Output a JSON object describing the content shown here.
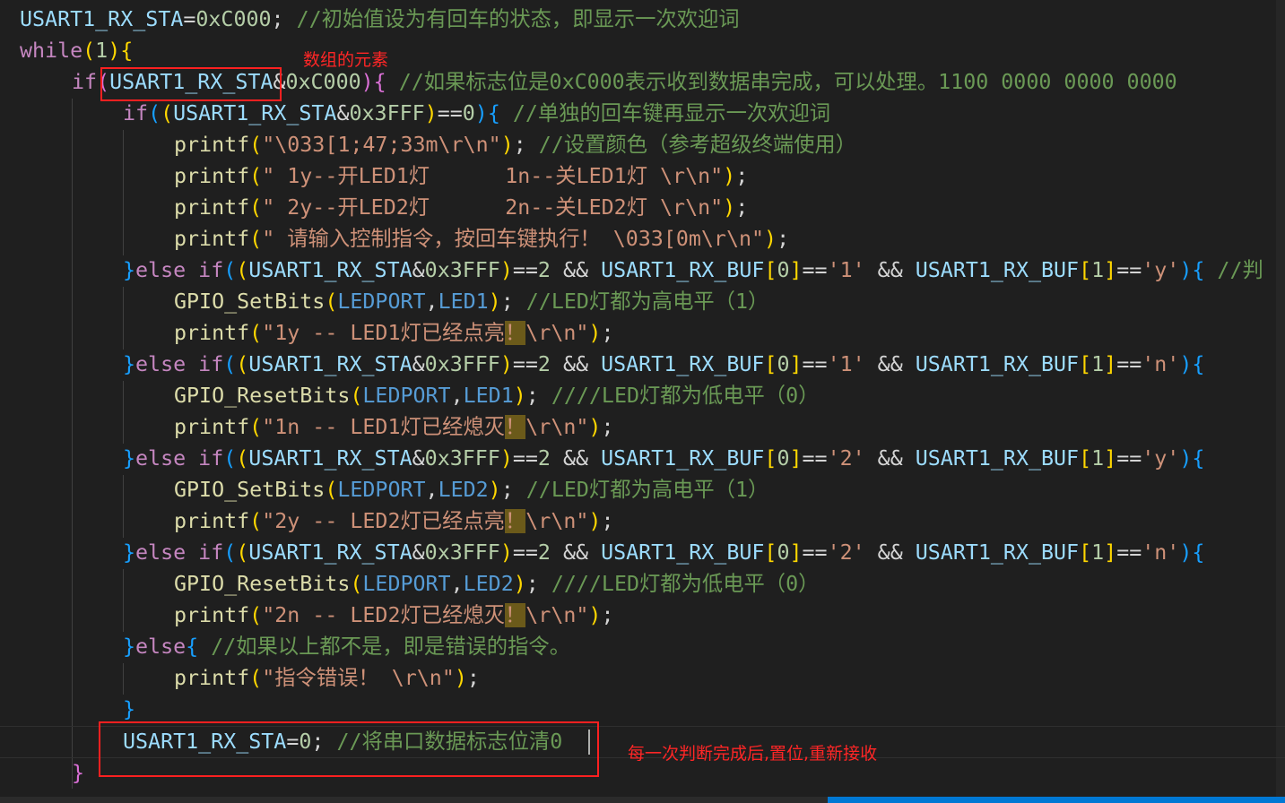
{
  "code": {
    "line0": [
      {
        "t": "USART1_RX_STA",
        "c": "t-var"
      },
      {
        "t": "=",
        "c": "t-op"
      },
      {
        "t": "0xC000",
        "c": "t-num"
      },
      {
        "t": "; ",
        "c": "t-op"
      },
      {
        "t": "//初始值设为有回车的状态，即显示一次欢迎词",
        "c": "t-com"
      }
    ],
    "line1": [
      {
        "t": "while",
        "c": "t-kw"
      },
      {
        "t": "(",
        "c": "t-b1"
      },
      {
        "t": "1",
        "c": "t-num"
      },
      {
        "t": ")",
        "c": "t-b1"
      },
      {
        "t": "{",
        "c": "t-b1"
      }
    ],
    "line2": [
      {
        "t": "if",
        "c": "t-kw"
      },
      {
        "t": "(",
        "c": "t-b2"
      },
      {
        "t": "USART1_RX_STA",
        "c": "t-var"
      },
      {
        "t": "&",
        "c": "t-op"
      },
      {
        "t": "0xC000",
        "c": "t-num"
      },
      {
        "t": ")",
        "c": "t-b2"
      },
      {
        "t": "{",
        "c": "t-b2"
      },
      {
        "t": " //如果标志位是0xC000表示收到数据串完成，可以处理。1100 0000 0000 0000",
        "c": "t-com"
      }
    ],
    "line3": [
      {
        "t": "if",
        "c": "t-kw"
      },
      {
        "t": "(",
        "c": "t-b3"
      },
      {
        "t": "(",
        "c": "t-b1"
      },
      {
        "t": "USART1_RX_STA",
        "c": "t-var"
      },
      {
        "t": "&",
        "c": "t-op"
      },
      {
        "t": "0x3FFF",
        "c": "t-num"
      },
      {
        "t": ")",
        "c": "t-b1"
      },
      {
        "t": "==",
        "c": "t-op"
      },
      {
        "t": "0",
        "c": "t-num"
      },
      {
        "t": ")",
        "c": "t-b3"
      },
      {
        "t": "{",
        "c": "t-b3"
      },
      {
        "t": " //单独的回车键再显示一次欢迎词",
        "c": "t-com"
      }
    ],
    "line4": [
      {
        "t": "printf",
        "c": "t-fn"
      },
      {
        "t": "(",
        "c": "t-b1"
      },
      {
        "t": "\"\\033[1;47;33m\\r\\n\"",
        "c": "t-str"
      },
      {
        "t": ")",
        "c": "t-b1"
      },
      {
        "t": "; ",
        "c": "t-op"
      },
      {
        "t": "//设置颜色（参考超级终端使用）",
        "c": "t-com"
      }
    ],
    "line5": [
      {
        "t": "printf",
        "c": "t-fn"
      },
      {
        "t": "(",
        "c": "t-b1"
      },
      {
        "t": "\" 1y--开LED1灯      1n--关LED1灯 \\r\\n\"",
        "c": "t-str"
      },
      {
        "t": ")",
        "c": "t-b1"
      },
      {
        "t": ";",
        "c": "t-op"
      }
    ],
    "line6": [
      {
        "t": "printf",
        "c": "t-fn"
      },
      {
        "t": "(",
        "c": "t-b1"
      },
      {
        "t": "\" 2y--开LED2灯      2n--关LED2灯 \\r\\n\"",
        "c": "t-str"
      },
      {
        "t": ")",
        "c": "t-b1"
      },
      {
        "t": ";",
        "c": "t-op"
      }
    ],
    "line7": [
      {
        "t": "printf",
        "c": "t-fn"
      },
      {
        "t": "(",
        "c": "t-b1"
      },
      {
        "t": "\" 请输入控制指令，按回车键执行！ \\033[0m\\r\\n\"",
        "c": "t-str"
      },
      {
        "t": ")",
        "c": "t-b1"
      },
      {
        "t": ";",
        "c": "t-op"
      }
    ],
    "line8": [
      {
        "t": "}",
        "c": "t-b3"
      },
      {
        "t": "else ",
        "c": "t-kw"
      },
      {
        "t": "if",
        "c": "t-kw"
      },
      {
        "t": "(",
        "c": "t-b3"
      },
      {
        "t": "(",
        "c": "t-b1"
      },
      {
        "t": "USART1_RX_STA",
        "c": "t-var"
      },
      {
        "t": "&",
        "c": "t-op"
      },
      {
        "t": "0x3FFF",
        "c": "t-num"
      },
      {
        "t": ")",
        "c": "t-b1"
      },
      {
        "t": "==",
        "c": "t-op"
      },
      {
        "t": "2",
        "c": "t-num"
      },
      {
        "t": " && ",
        "c": "t-op"
      },
      {
        "t": "USART1_RX_BUF",
        "c": "t-var"
      },
      {
        "t": "[",
        "c": "t-b1"
      },
      {
        "t": "0",
        "c": "t-num"
      },
      {
        "t": "]",
        "c": "t-b1"
      },
      {
        "t": "==",
        "c": "t-op"
      },
      {
        "t": "'1'",
        "c": "t-str"
      },
      {
        "t": " && ",
        "c": "t-op"
      },
      {
        "t": "USART1_RX_BUF",
        "c": "t-var"
      },
      {
        "t": "[",
        "c": "t-b1"
      },
      {
        "t": "1",
        "c": "t-num"
      },
      {
        "t": "]",
        "c": "t-b1"
      },
      {
        "t": "==",
        "c": "t-op"
      },
      {
        "t": "'y'",
        "c": "t-str"
      },
      {
        "t": ")",
        "c": "t-b3"
      },
      {
        "t": "{",
        "c": "t-b3"
      },
      {
        "t": " //判",
        "c": "t-com"
      }
    ],
    "line9": [
      {
        "t": "GPIO_SetBits",
        "c": "t-fn"
      },
      {
        "t": "(",
        "c": "t-b1"
      },
      {
        "t": "LEDPORT",
        "c": "t-mac"
      },
      {
        "t": ",",
        "c": "t-op"
      },
      {
        "t": "LED1",
        "c": "t-mac"
      },
      {
        "t": ")",
        "c": "t-b1"
      },
      {
        "t": "; ",
        "c": "t-op"
      },
      {
        "t": "//LED灯都为高电平（1）",
        "c": "t-com"
      }
    ],
    "line10": [
      {
        "t": "printf",
        "c": "t-fn"
      },
      {
        "t": "(",
        "c": "t-b1"
      },
      {
        "t": "\"1y -- LED1灯已经点亮",
        "c": "t-str"
      },
      {
        "t": "！",
        "c": "t-str t-warn"
      },
      {
        "t": "\\r\\n\"",
        "c": "t-str"
      },
      {
        "t": ")",
        "c": "t-b1"
      },
      {
        "t": ";",
        "c": "t-op"
      }
    ],
    "line11": [
      {
        "t": "}",
        "c": "t-b3"
      },
      {
        "t": "else ",
        "c": "t-kw"
      },
      {
        "t": "if",
        "c": "t-kw"
      },
      {
        "t": "(",
        "c": "t-b3"
      },
      {
        "t": "(",
        "c": "t-b1"
      },
      {
        "t": "USART1_RX_STA",
        "c": "t-var"
      },
      {
        "t": "&",
        "c": "t-op"
      },
      {
        "t": "0x3FFF",
        "c": "t-num"
      },
      {
        "t": ")",
        "c": "t-b1"
      },
      {
        "t": "==",
        "c": "t-op"
      },
      {
        "t": "2",
        "c": "t-num"
      },
      {
        "t": " && ",
        "c": "t-op"
      },
      {
        "t": "USART1_RX_BUF",
        "c": "t-var"
      },
      {
        "t": "[",
        "c": "t-b1"
      },
      {
        "t": "0",
        "c": "t-num"
      },
      {
        "t": "]",
        "c": "t-b1"
      },
      {
        "t": "==",
        "c": "t-op"
      },
      {
        "t": "'1'",
        "c": "t-str"
      },
      {
        "t": " && ",
        "c": "t-op"
      },
      {
        "t": "USART1_RX_BUF",
        "c": "t-var"
      },
      {
        "t": "[",
        "c": "t-b1"
      },
      {
        "t": "1",
        "c": "t-num"
      },
      {
        "t": "]",
        "c": "t-b1"
      },
      {
        "t": "==",
        "c": "t-op"
      },
      {
        "t": "'n'",
        "c": "t-str"
      },
      {
        "t": ")",
        "c": "t-b3"
      },
      {
        "t": "{",
        "c": "t-b3"
      }
    ],
    "line12": [
      {
        "t": "GPIO_ResetBits",
        "c": "t-fn"
      },
      {
        "t": "(",
        "c": "t-b1"
      },
      {
        "t": "LEDPORT",
        "c": "t-mac"
      },
      {
        "t": ",",
        "c": "t-op"
      },
      {
        "t": "LED1",
        "c": "t-mac"
      },
      {
        "t": ")",
        "c": "t-b1"
      },
      {
        "t": "; ",
        "c": "t-op"
      },
      {
        "t": "////LED灯都为低电平（0）",
        "c": "t-com"
      }
    ],
    "line13": [
      {
        "t": "printf",
        "c": "t-fn"
      },
      {
        "t": "(",
        "c": "t-b1"
      },
      {
        "t": "\"1n -- LED1灯已经熄灭",
        "c": "t-str"
      },
      {
        "t": "！",
        "c": "t-str t-warn"
      },
      {
        "t": "\\r\\n\"",
        "c": "t-str"
      },
      {
        "t": ")",
        "c": "t-b1"
      },
      {
        "t": ";",
        "c": "t-op"
      }
    ],
    "line14": [
      {
        "t": "}",
        "c": "t-b3"
      },
      {
        "t": "else ",
        "c": "t-kw"
      },
      {
        "t": "if",
        "c": "t-kw"
      },
      {
        "t": "(",
        "c": "t-b3"
      },
      {
        "t": "(",
        "c": "t-b1"
      },
      {
        "t": "USART1_RX_STA",
        "c": "t-var"
      },
      {
        "t": "&",
        "c": "t-op"
      },
      {
        "t": "0x3FFF",
        "c": "t-num"
      },
      {
        "t": ")",
        "c": "t-b1"
      },
      {
        "t": "==",
        "c": "t-op"
      },
      {
        "t": "2",
        "c": "t-num"
      },
      {
        "t": " && ",
        "c": "t-op"
      },
      {
        "t": "USART1_RX_BUF",
        "c": "t-var"
      },
      {
        "t": "[",
        "c": "t-b1"
      },
      {
        "t": "0",
        "c": "t-num"
      },
      {
        "t": "]",
        "c": "t-b1"
      },
      {
        "t": "==",
        "c": "t-op"
      },
      {
        "t": "'2'",
        "c": "t-str"
      },
      {
        "t": " && ",
        "c": "t-op"
      },
      {
        "t": "USART1_RX_BUF",
        "c": "t-var"
      },
      {
        "t": "[",
        "c": "t-b1"
      },
      {
        "t": "1",
        "c": "t-num"
      },
      {
        "t": "]",
        "c": "t-b1"
      },
      {
        "t": "==",
        "c": "t-op"
      },
      {
        "t": "'y'",
        "c": "t-str"
      },
      {
        "t": ")",
        "c": "t-b3"
      },
      {
        "t": "{",
        "c": "t-b3"
      }
    ],
    "line15": [
      {
        "t": "GPIO_SetBits",
        "c": "t-fn"
      },
      {
        "t": "(",
        "c": "t-b1"
      },
      {
        "t": "LEDPORT",
        "c": "t-mac"
      },
      {
        "t": ",",
        "c": "t-op"
      },
      {
        "t": "LED2",
        "c": "t-mac"
      },
      {
        "t": ")",
        "c": "t-b1"
      },
      {
        "t": "; ",
        "c": "t-op"
      },
      {
        "t": "//LED灯都为高电平（1）",
        "c": "t-com"
      }
    ],
    "line16": [
      {
        "t": "printf",
        "c": "t-fn"
      },
      {
        "t": "(",
        "c": "t-b1"
      },
      {
        "t": "\"2y -- LED2灯已经点亮",
        "c": "t-str"
      },
      {
        "t": "！",
        "c": "t-str t-warn"
      },
      {
        "t": "\\r\\n\"",
        "c": "t-str"
      },
      {
        "t": ")",
        "c": "t-b1"
      },
      {
        "t": ";",
        "c": "t-op"
      }
    ],
    "line17": [
      {
        "t": "}",
        "c": "t-b3"
      },
      {
        "t": "else ",
        "c": "t-kw"
      },
      {
        "t": "if",
        "c": "t-kw"
      },
      {
        "t": "(",
        "c": "t-b3"
      },
      {
        "t": "(",
        "c": "t-b1"
      },
      {
        "t": "USART1_RX_STA",
        "c": "t-var"
      },
      {
        "t": "&",
        "c": "t-op"
      },
      {
        "t": "0x3FFF",
        "c": "t-num"
      },
      {
        "t": ")",
        "c": "t-b1"
      },
      {
        "t": "==",
        "c": "t-op"
      },
      {
        "t": "2",
        "c": "t-num"
      },
      {
        "t": " && ",
        "c": "t-op"
      },
      {
        "t": "USART1_RX_BUF",
        "c": "t-var"
      },
      {
        "t": "[",
        "c": "t-b1"
      },
      {
        "t": "0",
        "c": "t-num"
      },
      {
        "t": "]",
        "c": "t-b1"
      },
      {
        "t": "==",
        "c": "t-op"
      },
      {
        "t": "'2'",
        "c": "t-str"
      },
      {
        "t": " && ",
        "c": "t-op"
      },
      {
        "t": "USART1_RX_BUF",
        "c": "t-var"
      },
      {
        "t": "[",
        "c": "t-b1"
      },
      {
        "t": "1",
        "c": "t-num"
      },
      {
        "t": "]",
        "c": "t-b1"
      },
      {
        "t": "==",
        "c": "t-op"
      },
      {
        "t": "'n'",
        "c": "t-str"
      },
      {
        "t": ")",
        "c": "t-b3"
      },
      {
        "t": "{",
        "c": "t-b3"
      }
    ],
    "line18": [
      {
        "t": "GPIO_ResetBits",
        "c": "t-fn"
      },
      {
        "t": "(",
        "c": "t-b1"
      },
      {
        "t": "LEDPORT",
        "c": "t-mac"
      },
      {
        "t": ",",
        "c": "t-op"
      },
      {
        "t": "LED2",
        "c": "t-mac"
      },
      {
        "t": ")",
        "c": "t-b1"
      },
      {
        "t": "; ",
        "c": "t-op"
      },
      {
        "t": "////LED灯都为低电平（0）",
        "c": "t-com"
      }
    ],
    "line19": [
      {
        "t": "printf",
        "c": "t-fn"
      },
      {
        "t": "(",
        "c": "t-b1"
      },
      {
        "t": "\"2n -- LED2灯已经熄灭",
        "c": "t-str"
      },
      {
        "t": "！",
        "c": "t-str t-warn"
      },
      {
        "t": "\\r\\n\"",
        "c": "t-str"
      },
      {
        "t": ")",
        "c": "t-b1"
      },
      {
        "t": ";",
        "c": "t-op"
      }
    ],
    "line20": [
      {
        "t": "}",
        "c": "t-b3"
      },
      {
        "t": "else",
        "c": "t-kw"
      },
      {
        "t": "{",
        "c": "t-b3"
      },
      {
        "t": " //如果以上都不是，即是错误的指令。",
        "c": "t-com"
      }
    ],
    "line21": [
      {
        "t": "printf",
        "c": "t-fn"
      },
      {
        "t": "(",
        "c": "t-b1"
      },
      {
        "t": "\"指令错误！ \\r\\n\"",
        "c": "t-str"
      },
      {
        "t": ")",
        "c": "t-b1"
      },
      {
        "t": ";",
        "c": "t-op"
      }
    ],
    "line22": [
      {
        "t": "}",
        "c": "t-b3"
      }
    ],
    "line23": [
      {
        "t": "USART1_RX_STA",
        "c": "t-var"
      },
      {
        "t": "=",
        "c": "t-op"
      },
      {
        "t": "0",
        "c": "t-num"
      },
      {
        "t": "; ",
        "c": "t-op"
      },
      {
        "t": "//将串口数据标志位清0",
        "c": "t-com"
      }
    ],
    "line24": [
      {
        "t": "}",
        "c": "t-b2"
      }
    ]
  },
  "annotations": {
    "array_element": "数组的元素",
    "reset_note": "每一次判断完成后,置位,重新接收"
  },
  "colors": {
    "annotation_red": "#ff2020",
    "editor_background": "#1f1f1f"
  }
}
